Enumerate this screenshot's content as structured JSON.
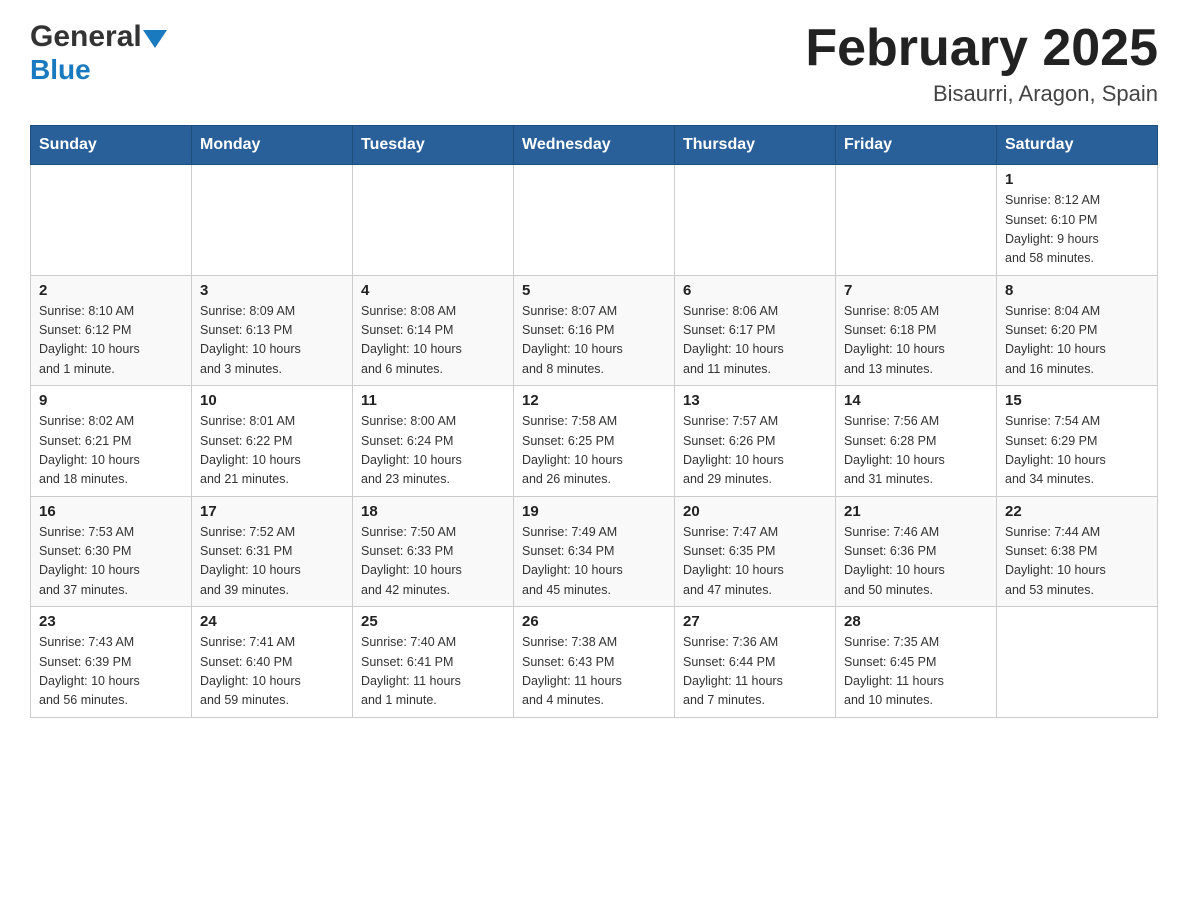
{
  "header": {
    "logo_general": "General",
    "logo_blue": "Blue",
    "month": "February 2025",
    "location": "Bisaurri, Aragon, Spain"
  },
  "days_of_week": [
    "Sunday",
    "Monday",
    "Tuesday",
    "Wednesday",
    "Thursday",
    "Friday",
    "Saturday"
  ],
  "weeks": [
    [
      {
        "day": "",
        "info": ""
      },
      {
        "day": "",
        "info": ""
      },
      {
        "day": "",
        "info": ""
      },
      {
        "day": "",
        "info": ""
      },
      {
        "day": "",
        "info": ""
      },
      {
        "day": "",
        "info": ""
      },
      {
        "day": "1",
        "info": "Sunrise: 8:12 AM\nSunset: 6:10 PM\nDaylight: 9 hours\nand 58 minutes."
      }
    ],
    [
      {
        "day": "2",
        "info": "Sunrise: 8:10 AM\nSunset: 6:12 PM\nDaylight: 10 hours\nand 1 minute."
      },
      {
        "day": "3",
        "info": "Sunrise: 8:09 AM\nSunset: 6:13 PM\nDaylight: 10 hours\nand 3 minutes."
      },
      {
        "day": "4",
        "info": "Sunrise: 8:08 AM\nSunset: 6:14 PM\nDaylight: 10 hours\nand 6 minutes."
      },
      {
        "day": "5",
        "info": "Sunrise: 8:07 AM\nSunset: 6:16 PM\nDaylight: 10 hours\nand 8 minutes."
      },
      {
        "day": "6",
        "info": "Sunrise: 8:06 AM\nSunset: 6:17 PM\nDaylight: 10 hours\nand 11 minutes."
      },
      {
        "day": "7",
        "info": "Sunrise: 8:05 AM\nSunset: 6:18 PM\nDaylight: 10 hours\nand 13 minutes."
      },
      {
        "day": "8",
        "info": "Sunrise: 8:04 AM\nSunset: 6:20 PM\nDaylight: 10 hours\nand 16 minutes."
      }
    ],
    [
      {
        "day": "9",
        "info": "Sunrise: 8:02 AM\nSunset: 6:21 PM\nDaylight: 10 hours\nand 18 minutes."
      },
      {
        "day": "10",
        "info": "Sunrise: 8:01 AM\nSunset: 6:22 PM\nDaylight: 10 hours\nand 21 minutes."
      },
      {
        "day": "11",
        "info": "Sunrise: 8:00 AM\nSunset: 6:24 PM\nDaylight: 10 hours\nand 23 minutes."
      },
      {
        "day": "12",
        "info": "Sunrise: 7:58 AM\nSunset: 6:25 PM\nDaylight: 10 hours\nand 26 minutes."
      },
      {
        "day": "13",
        "info": "Sunrise: 7:57 AM\nSunset: 6:26 PM\nDaylight: 10 hours\nand 29 minutes."
      },
      {
        "day": "14",
        "info": "Sunrise: 7:56 AM\nSunset: 6:28 PM\nDaylight: 10 hours\nand 31 minutes."
      },
      {
        "day": "15",
        "info": "Sunrise: 7:54 AM\nSunset: 6:29 PM\nDaylight: 10 hours\nand 34 minutes."
      }
    ],
    [
      {
        "day": "16",
        "info": "Sunrise: 7:53 AM\nSunset: 6:30 PM\nDaylight: 10 hours\nand 37 minutes."
      },
      {
        "day": "17",
        "info": "Sunrise: 7:52 AM\nSunset: 6:31 PM\nDaylight: 10 hours\nand 39 minutes."
      },
      {
        "day": "18",
        "info": "Sunrise: 7:50 AM\nSunset: 6:33 PM\nDaylight: 10 hours\nand 42 minutes."
      },
      {
        "day": "19",
        "info": "Sunrise: 7:49 AM\nSunset: 6:34 PM\nDaylight: 10 hours\nand 45 minutes."
      },
      {
        "day": "20",
        "info": "Sunrise: 7:47 AM\nSunset: 6:35 PM\nDaylight: 10 hours\nand 47 minutes."
      },
      {
        "day": "21",
        "info": "Sunrise: 7:46 AM\nSunset: 6:36 PM\nDaylight: 10 hours\nand 50 minutes."
      },
      {
        "day": "22",
        "info": "Sunrise: 7:44 AM\nSunset: 6:38 PM\nDaylight: 10 hours\nand 53 minutes."
      }
    ],
    [
      {
        "day": "23",
        "info": "Sunrise: 7:43 AM\nSunset: 6:39 PM\nDaylight: 10 hours\nand 56 minutes."
      },
      {
        "day": "24",
        "info": "Sunrise: 7:41 AM\nSunset: 6:40 PM\nDaylight: 10 hours\nand 59 minutes."
      },
      {
        "day": "25",
        "info": "Sunrise: 7:40 AM\nSunset: 6:41 PM\nDaylight: 11 hours\nand 1 minute."
      },
      {
        "day": "26",
        "info": "Sunrise: 7:38 AM\nSunset: 6:43 PM\nDaylight: 11 hours\nand 4 minutes."
      },
      {
        "day": "27",
        "info": "Sunrise: 7:36 AM\nSunset: 6:44 PM\nDaylight: 11 hours\nand 7 minutes."
      },
      {
        "day": "28",
        "info": "Sunrise: 7:35 AM\nSunset: 6:45 PM\nDaylight: 11 hours\nand 10 minutes."
      },
      {
        "day": "",
        "info": ""
      }
    ]
  ]
}
